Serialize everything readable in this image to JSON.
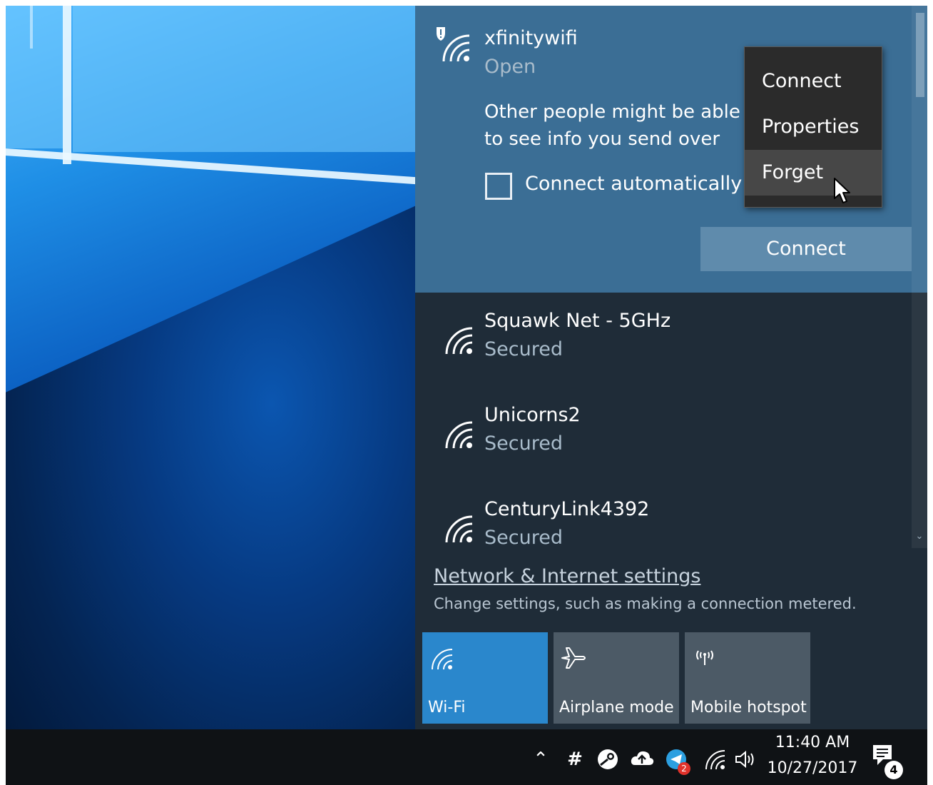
{
  "flyout": {
    "selected_network": {
      "name": "xfinitywifi",
      "status": "Open",
      "warning": "Other people might be able to see info you send over this network",
      "connect_auto_label": "Connect automatically",
      "connect_auto_checked": false,
      "connect_button": "Connect"
    },
    "networks": [
      {
        "name": "Squawk Net - 5GHz",
        "status": "Secured"
      },
      {
        "name": "Unicorns2",
        "status": "Secured"
      },
      {
        "name": "CenturyLink4392",
        "status": "Secured"
      }
    ],
    "settings_link": "Network & Internet settings",
    "settings_desc": "Change settings, such as making a connection metered.",
    "quick_actions": [
      {
        "label": "Wi-Fi",
        "icon": "wifi-icon",
        "active": true
      },
      {
        "label": "Airplane mode",
        "icon": "airplane-icon",
        "active": false
      },
      {
        "label": "Mobile hotspot",
        "icon": "hotspot-icon",
        "active": false
      }
    ]
  },
  "context_menu": {
    "items": [
      "Connect",
      "Properties",
      "Forget"
    ],
    "hovered": "Forget"
  },
  "taskbar": {
    "time": "11:40 AM",
    "date": "10/27/2017",
    "notification_count": "4",
    "tray_badge_count": "2"
  },
  "colors": {
    "flyout_bg": "#1f2c38",
    "selected_bg": "#3b6e95",
    "accent": "#2a87cc",
    "taskbar_bg": "#0f1215"
  }
}
